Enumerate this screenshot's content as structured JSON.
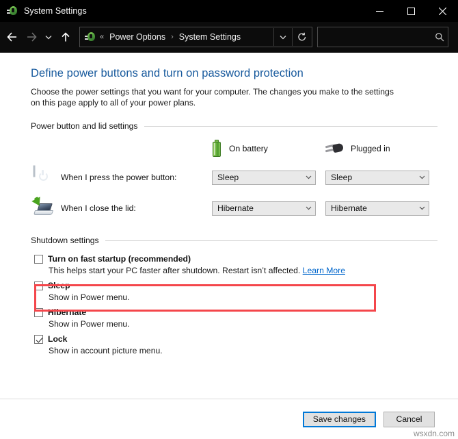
{
  "window": {
    "title": "System Settings",
    "app_icon": "power-options-icon",
    "controls": {
      "minimize": "—",
      "maximize": "□",
      "close": "✕"
    }
  },
  "navbar": {
    "back_icon": "←",
    "forward_icon": "→",
    "history_icon": "ⱽ",
    "up_icon": "↑",
    "breadcrumb": {
      "icon": "power-options-icon",
      "overflow": "«",
      "items": [
        "Power Options",
        "System Settings"
      ],
      "separator": "›"
    },
    "address_dropdown_icon": "ⱽ",
    "refresh_icon": "↻",
    "search": {
      "value": "",
      "placeholder": "",
      "icon": "⚲"
    }
  },
  "page": {
    "title": "Define power buttons and turn on password protection",
    "description": "Choose the power settings that you want for your computer. The changes you make to the settings on this page apply to all of your power plans."
  },
  "power_group": {
    "heading": "Power button and lid settings",
    "columns": [
      {
        "label": "On battery",
        "icon": "battery-icon"
      },
      {
        "label": "Plugged in",
        "icon": "power-plug-icon"
      }
    ],
    "rows": [
      {
        "icon": "power-button-icon",
        "label": "When I press the power button:",
        "on_battery": "Sleep",
        "plugged_in": "Sleep",
        "dropdown_arrow": "ⱽ"
      },
      {
        "icon": "laptop-lid-icon",
        "label": "When I close the lid:",
        "on_battery": "Hibernate",
        "plugged_in": "Hibernate",
        "dropdown_arrow": "ⱽ"
      }
    ]
  },
  "shutdown_group": {
    "heading": "Shutdown settings",
    "items": [
      {
        "title": "Turn on fast startup (recommended)",
        "checked": false,
        "description": "This helps start your PC faster after shutdown. Restart isn’t affected.",
        "link": "Learn More",
        "highlighted": true
      },
      {
        "title": "Sleep",
        "checked": false,
        "description": "Show in Power menu.",
        "link": "",
        "highlighted": false
      },
      {
        "title": "Hibernate",
        "checked": false,
        "description": "Show in Power menu.",
        "link": "",
        "highlighted": false
      },
      {
        "title": "Lock",
        "checked": true,
        "description": "Show in account picture menu.",
        "link": "",
        "highlighted": false
      }
    ]
  },
  "footer": {
    "save_label": "Save changes",
    "cancel_label": "Cancel"
  },
  "watermark": "wsxdn.com",
  "colors": {
    "title_blue": "#185a9d",
    "link_blue": "#0066cc",
    "highlight_red": "#f4464b",
    "focus_blue": "#0078d7",
    "battery_green": "#6cb33f"
  }
}
